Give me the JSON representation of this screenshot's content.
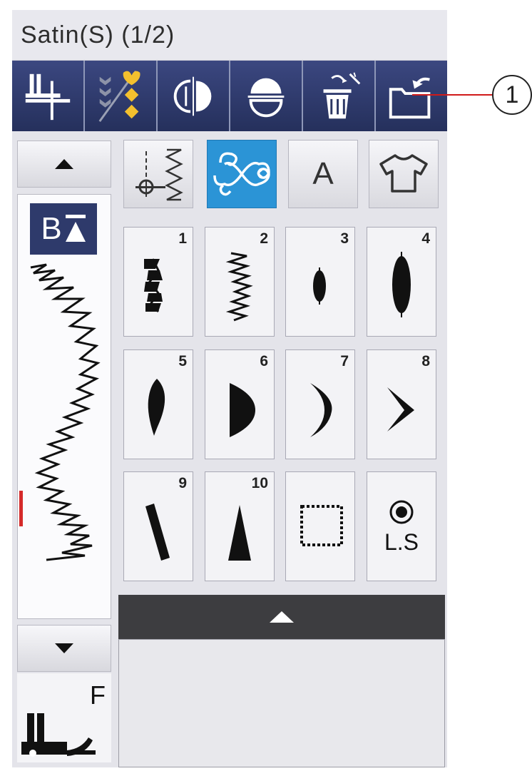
{
  "title": "Satin(S) (1/2)",
  "toolbar": {
    "buttons": [
      {
        "name": "presser-foot-icon"
      },
      {
        "name": "mirror-stitch-icon"
      },
      {
        "name": "mirror-image-icon"
      },
      {
        "name": "elongation-icon"
      },
      {
        "name": "delete-icon"
      },
      {
        "name": "open-folder-icon"
      }
    ]
  },
  "callout": "1",
  "accent_color": "#2b94d6",
  "badge_letter": "B",
  "foot_letter": "F",
  "categories": [
    {
      "name": "utility-stitch-icon"
    },
    {
      "name": "decorative-stitch-icon",
      "active": true
    },
    {
      "name": "letter",
      "label": "A"
    },
    {
      "name": "garment-icon"
    }
  ],
  "patterns": [
    {
      "num": "1",
      "icon": "satin-zigzag-1"
    },
    {
      "num": "2",
      "icon": "satin-zigzag-2"
    },
    {
      "num": "3",
      "icon": "satin-oval-small"
    },
    {
      "num": "4",
      "icon": "satin-oval-large"
    },
    {
      "num": "5",
      "icon": "satin-leaf"
    },
    {
      "num": "6",
      "icon": "satin-half-moon"
    },
    {
      "num": "7",
      "icon": "satin-crescent"
    },
    {
      "num": "8",
      "icon": "satin-chevron"
    },
    {
      "num": "9",
      "icon": "satin-slant-bar"
    },
    {
      "num": "10",
      "icon": "satin-triangle"
    },
    {
      "num": "",
      "icon": "dotted-square"
    },
    {
      "num": "",
      "icon": "lock-stitch",
      "label": "L.S"
    }
  ]
}
